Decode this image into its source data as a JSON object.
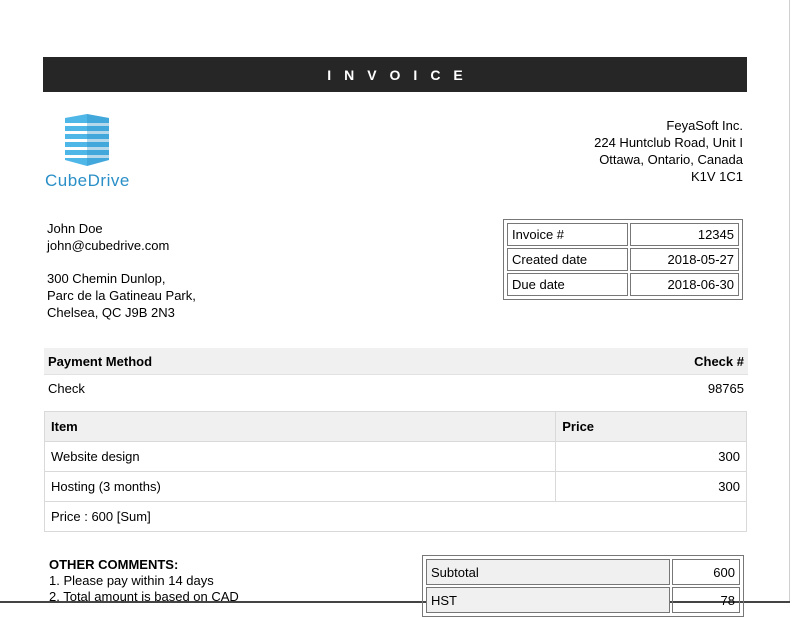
{
  "banner": {
    "title": "INVOICE"
  },
  "logo": {
    "text": "CubeDrive"
  },
  "company": {
    "name": "FeyaSoft Inc.",
    "street": "224 Huntclub Road, Unit I",
    "city": "Ottawa, Ontario, Canada",
    "postal": "K1V 1C1"
  },
  "customer": {
    "name": "John Doe",
    "email": "john@cubedrive.com",
    "address_line1": "300 Chemin Dunlop,",
    "address_line2": "Parc de la Gatineau Park,",
    "address_line3": "Chelsea, QC J9B 2N3"
  },
  "meta": {
    "rows": [
      {
        "label": "Invoice #",
        "value": "12345"
      },
      {
        "label": "Created date",
        "value": "2018-05-27"
      },
      {
        "label": "Due date",
        "value": "2018-06-30"
      }
    ]
  },
  "payment": {
    "method_header": "Payment Method",
    "check_header": "Check #",
    "method": "Check",
    "check_number": "98765"
  },
  "items": {
    "header_item": "Item",
    "header_price": "Price",
    "rows": [
      {
        "item": "Website design",
        "price": "300"
      },
      {
        "item": "Hosting (3 months)",
        "price": "300"
      }
    ],
    "sum_text": "Price : 600 [Sum]"
  },
  "comments": {
    "title": "OTHER COMMENTS:",
    "line1": "1. Please pay within 14 days",
    "line2": "2. Total amount is based on CAD"
  },
  "totals": {
    "rows": [
      {
        "label": "Subtotal",
        "value": "600"
      },
      {
        "label": "HST",
        "value": "78"
      }
    ]
  }
}
